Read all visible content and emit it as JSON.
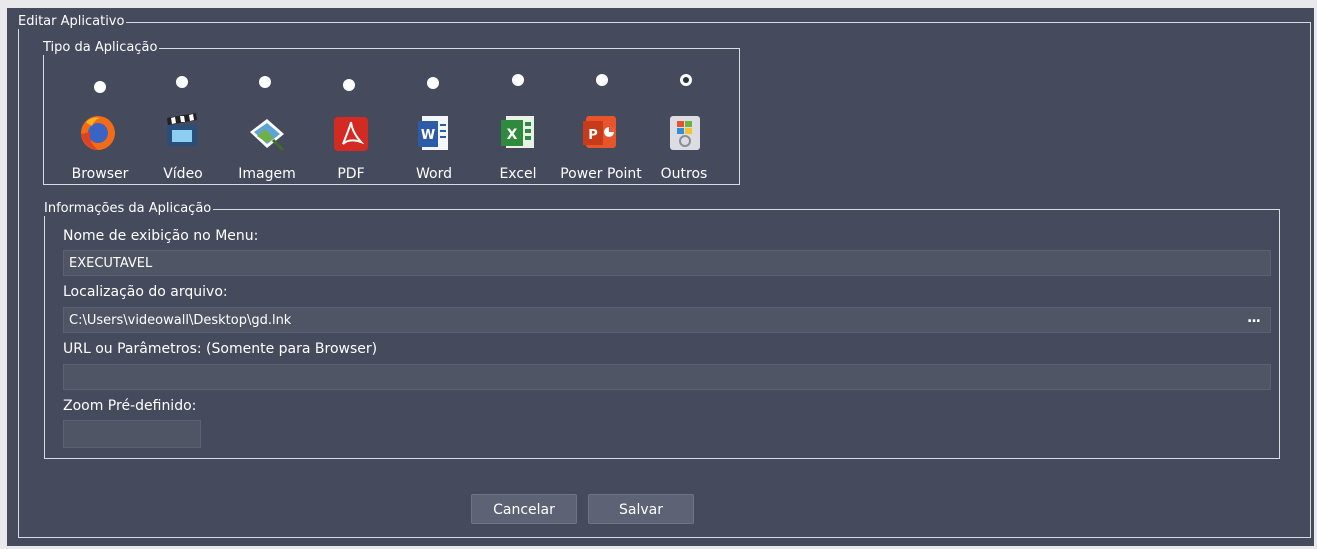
{
  "group_titles": {
    "outer": "Editar Aplicativo",
    "tipo": "Tipo da Aplicação",
    "info": "Informações da Aplicação"
  },
  "app_types": [
    {
      "label": "Browser",
      "icon": "firefox-icon",
      "selected": false
    },
    {
      "label": "Vídeo",
      "icon": "clapperboard-icon",
      "selected": false
    },
    {
      "label": "Imagem",
      "icon": "image-icon",
      "selected": false
    },
    {
      "label": "PDF",
      "icon": "pdf-icon",
      "selected": false
    },
    {
      "label": "Word",
      "icon": "word-icon",
      "selected": false
    },
    {
      "label": "Excel",
      "icon": "excel-icon",
      "selected": false
    },
    {
      "label": "Power Point",
      "icon": "powerpoint-icon",
      "selected": false
    },
    {
      "label": "Outros",
      "icon": "windows-generic-icon",
      "selected": true
    }
  ],
  "fields": {
    "name_label": "Nome de exibição no Menu:",
    "name_value": "EXECUTÁVEL",
    "location_label": "Localização do arquivo:",
    "location_value": "C:\\Users\\videowall\\Desktop\\gd.lnk",
    "browse_label": "...",
    "url_label": "URL ou Parâmetros: (Somente para Browser)",
    "url_value": "",
    "zoom_label": "Zoom Pré-definido:",
    "zoom_value": ""
  },
  "buttons": {
    "cancel": "Cancelar",
    "save": "Salvar"
  },
  "colors": {
    "background": "#454a5c",
    "field": "#505565",
    "button": "#5d6274"
  }
}
